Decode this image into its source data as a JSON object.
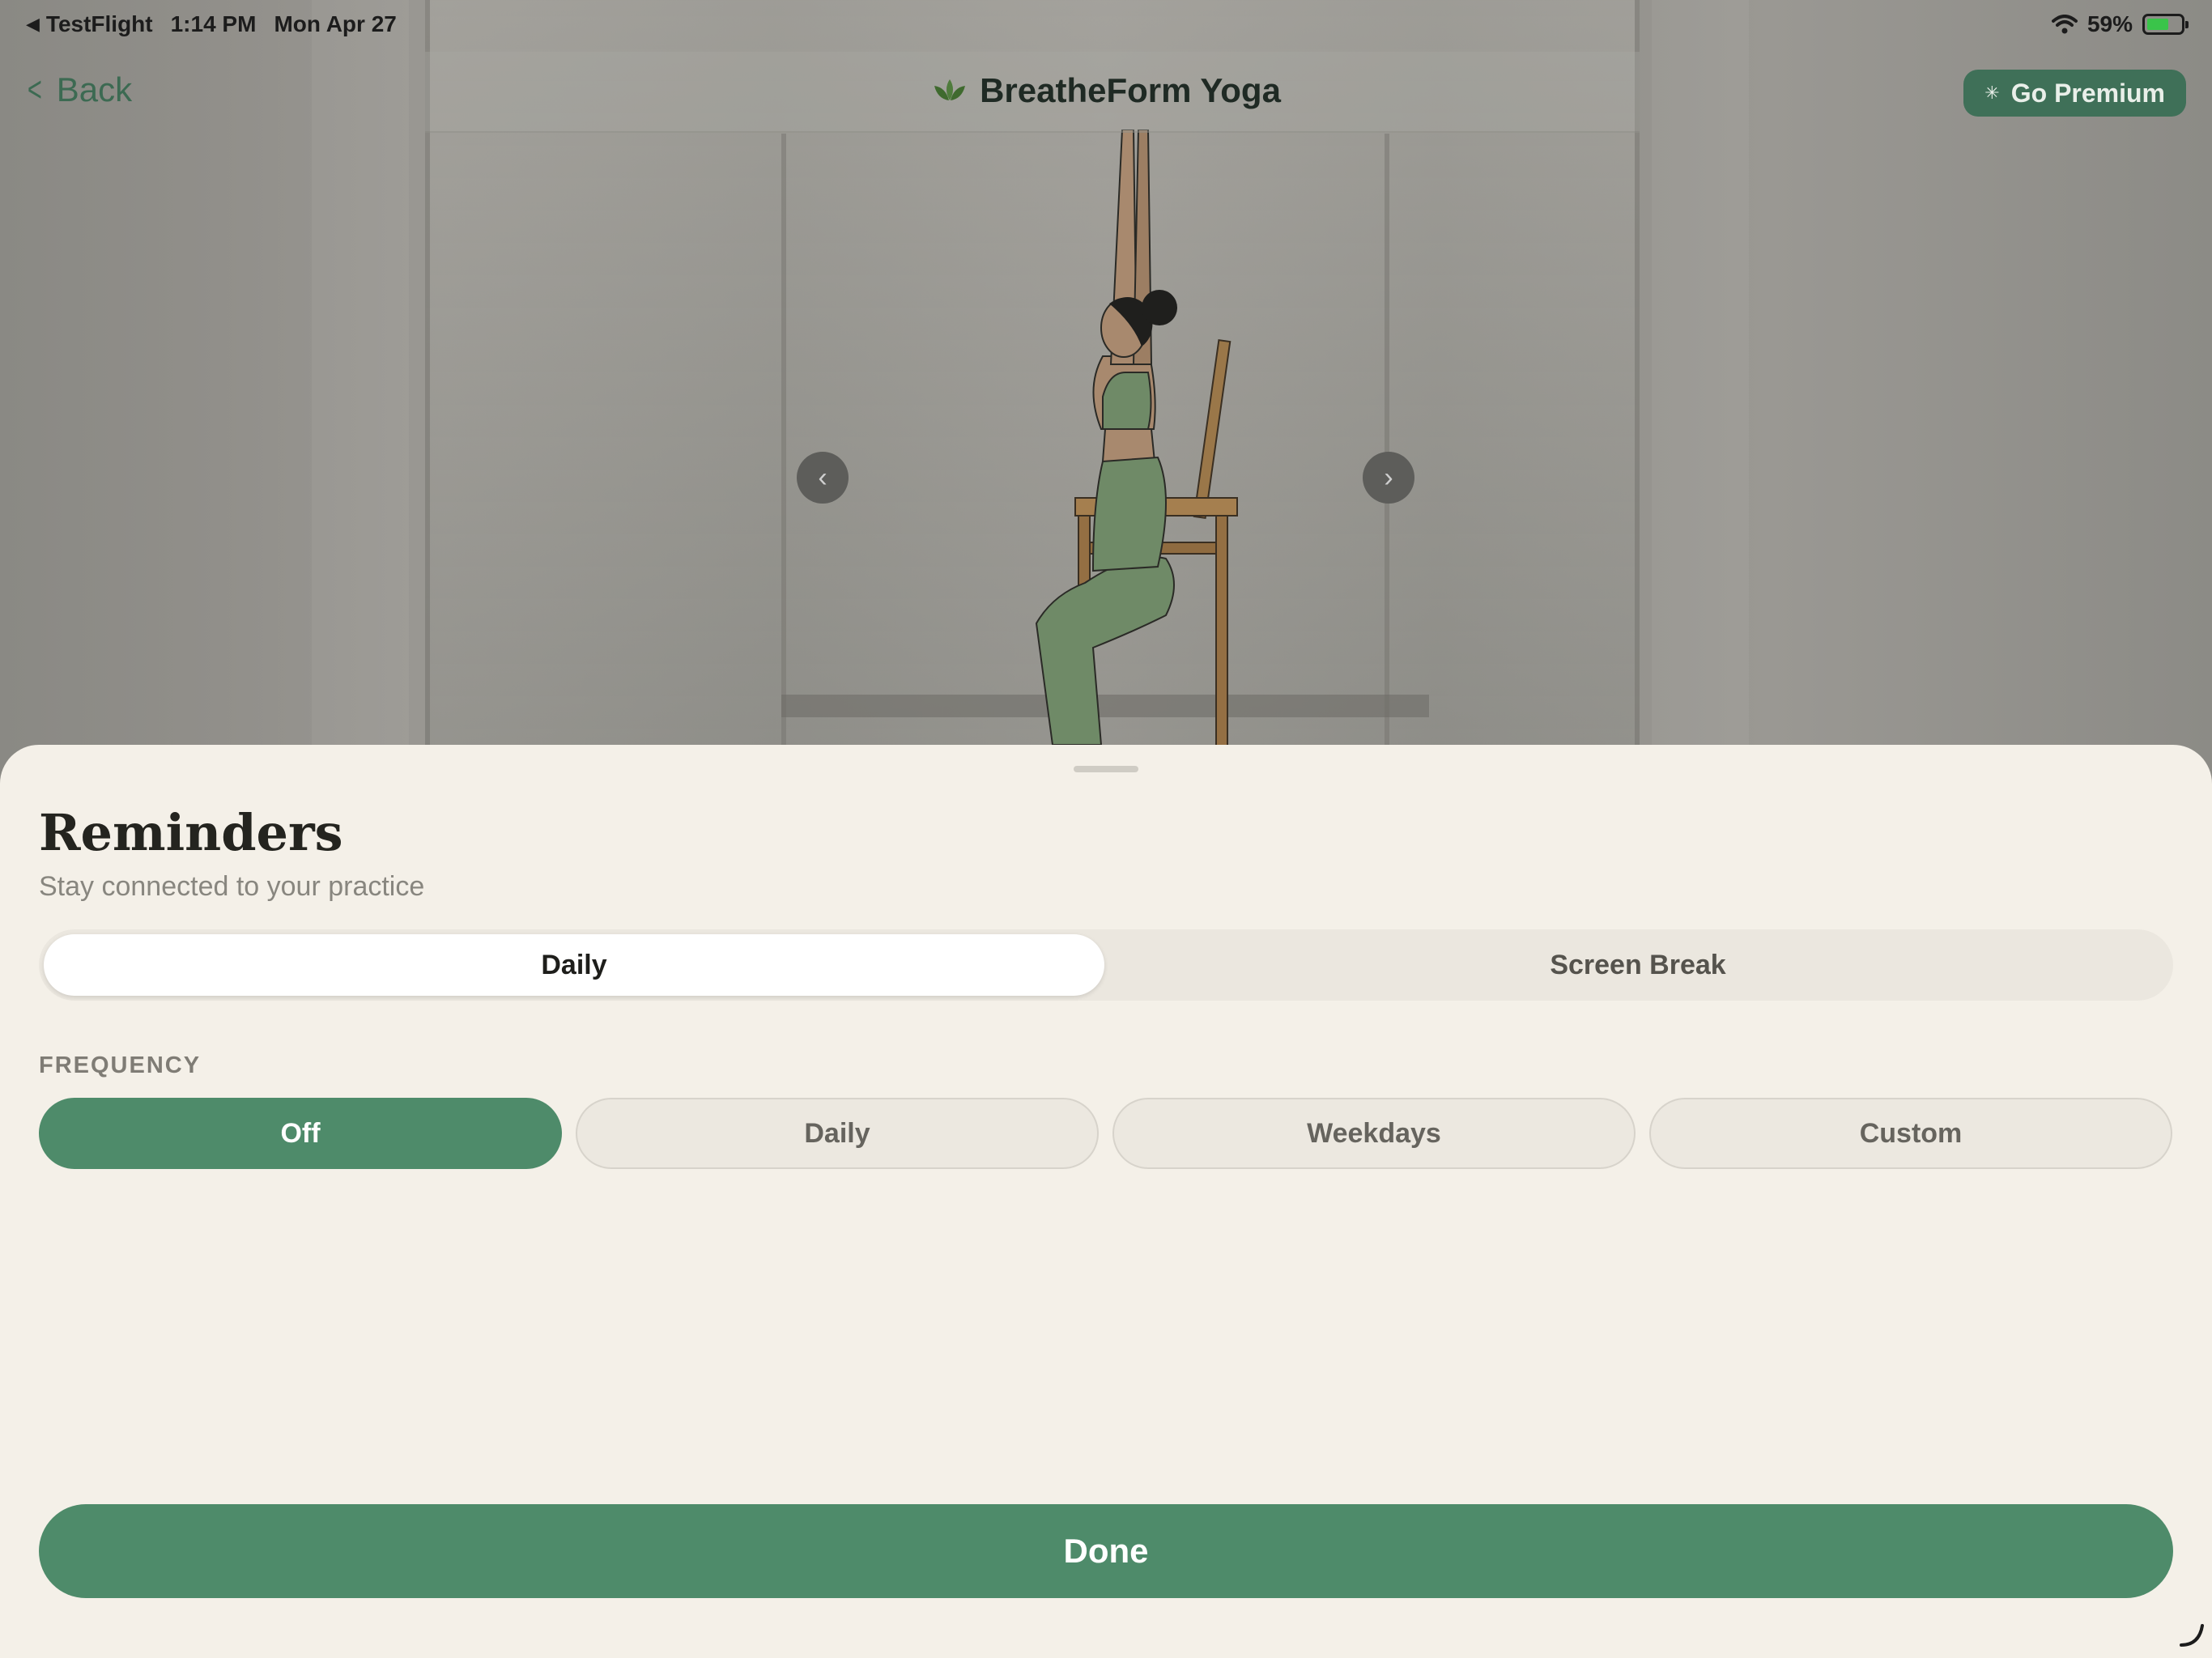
{
  "status_bar": {
    "back_app": "TestFlight",
    "time": "1:14 PM",
    "date": "Mon Apr 27",
    "battery": "59%"
  },
  "nav": {
    "back_label": "Back",
    "app_title": "BreatheForm Yoga",
    "premium_label": "Go Premium"
  },
  "carousel": {
    "prev_icon": "chevron-left-icon",
    "next_icon": "chevron-right-icon"
  },
  "sheet": {
    "title": "Reminders",
    "subtitle": "Stay connected to your practice",
    "tabs": [
      {
        "label": "Daily",
        "selected": true
      },
      {
        "label": "Screen Break",
        "selected": false
      }
    ],
    "frequency_label": "FREQUENCY",
    "frequency_options": [
      {
        "label": "Off",
        "selected": true
      },
      {
        "label": "Daily",
        "selected": false
      },
      {
        "label": "Weekdays",
        "selected": false
      },
      {
        "label": "Custom",
        "selected": false
      }
    ],
    "done_label": "Done"
  },
  "colors": {
    "accent": "#4e8b6a",
    "premium": "#3f7058",
    "sheet_bg": "#f4f0e8",
    "back_link": "#3c6a52"
  }
}
